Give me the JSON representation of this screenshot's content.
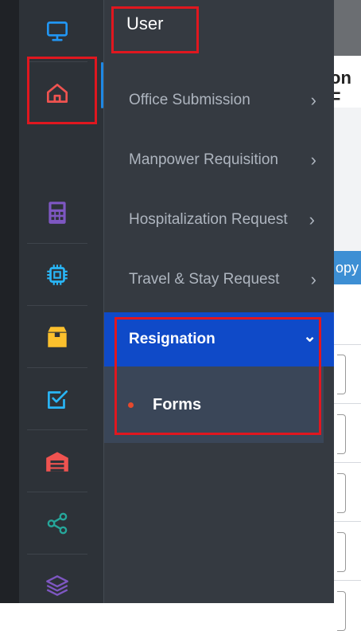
{
  "header": {
    "title": "User"
  },
  "icon_rail": [
    {
      "icon": "monitor-icon",
      "color": "#2196f3"
    },
    {
      "icon": "home-icon",
      "color": "#ef5350"
    },
    {
      "icon": "calculator-icon",
      "color": "#7e57c2"
    },
    {
      "icon": "chip-icon",
      "color": "#29b6f6"
    },
    {
      "icon": "box-icon",
      "color": "#fbc02d"
    },
    {
      "icon": "checkbox-icon",
      "color": "#29b6f6"
    },
    {
      "icon": "warehouse-icon",
      "color": "#ef5350"
    },
    {
      "icon": "share-icon",
      "color": "#26a69a"
    },
    {
      "icon": "layers-icon",
      "color": "#7e57c2"
    }
  ],
  "menu": {
    "items": [
      {
        "label": "Office Submission",
        "chevron": "›"
      },
      {
        "label": "Manpower Requisition",
        "chevron": "›"
      },
      {
        "label": "Hospitalization Request",
        "chevron": "›"
      },
      {
        "label": "Travel & Stay Request",
        "chevron": "›"
      },
      {
        "label": "Resignation",
        "chevron": "⌄"
      }
    ],
    "sub_items": [
      {
        "label": "Forms"
      }
    ]
  },
  "background": {
    "heading_fragment": "on F",
    "button_fragment": "opy"
  },
  "colors": {
    "accent_blue": "#0f4ac8",
    "highlight_red": "#e0171f",
    "bullet_red": "#e6492d"
  }
}
